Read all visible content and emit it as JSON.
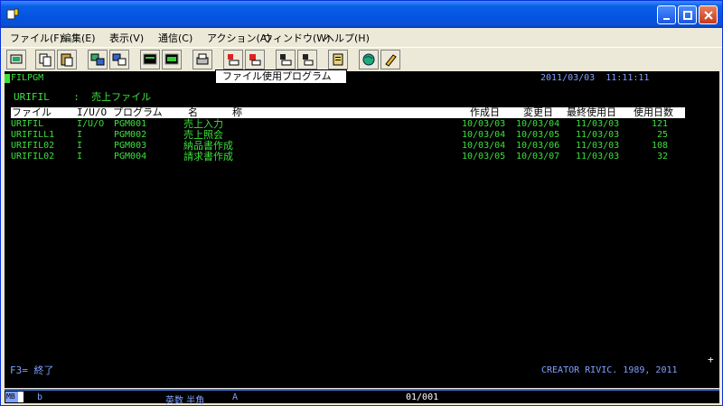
{
  "window": {
    "menu": [
      "ファイル(F)",
      "編集(E)",
      "表示(V)",
      "通信(C)",
      "アクション(A)",
      "ウィンドウ(W)",
      "ヘルプ(H)"
    ],
    "tooltip": "ファイル使用プログラム"
  },
  "screen": {
    "screen_id": "FILPGM",
    "datetime": "2011/03/03  11:11:11",
    "file_label": "URIFIL    :  売上ファイル",
    "columns": [
      "ファイル",
      "I/U/O",
      "プログラム",
      "名",
      "称",
      "作成日",
      "変更日",
      "最終使用日",
      "使用日数"
    ],
    "rows": [
      {
        "file": "URIFIL",
        "iuo": "I/U/O",
        "program": "PGM001",
        "name": "売上入力",
        "created": "10/03/03",
        "changed": "10/03/04",
        "last_used": "11/03/03",
        "days": "121"
      },
      {
        "file": "URIFILL1",
        "iuo": "I",
        "program": "PGM002",
        "name": "売上照会",
        "created": "10/03/04",
        "changed": "10/03/05",
        "last_used": "11/03/03",
        "days": "25"
      },
      {
        "file": "URIFIL02",
        "iuo": "I",
        "program": "PGM003",
        "name": "納品書作成",
        "created": "10/03/04",
        "changed": "10/03/06",
        "last_used": "11/03/03",
        "days": "108"
      },
      {
        "file": "URIFIL02",
        "iuo": "I",
        "program": "PGM004",
        "name": "請求書作成",
        "created": "10/03/05",
        "changed": "10/03/07",
        "last_used": "11/03/03",
        "days": "32"
      }
    ],
    "fkey": "F3= 終了",
    "copyright": "CREATOR RIVIC. 1989, 2011",
    "plus": "+"
  },
  "status": {
    "mb": "MB",
    "b": "b",
    "mode": "英数 半角",
    "a": "A",
    "position": "01/001"
  }
}
